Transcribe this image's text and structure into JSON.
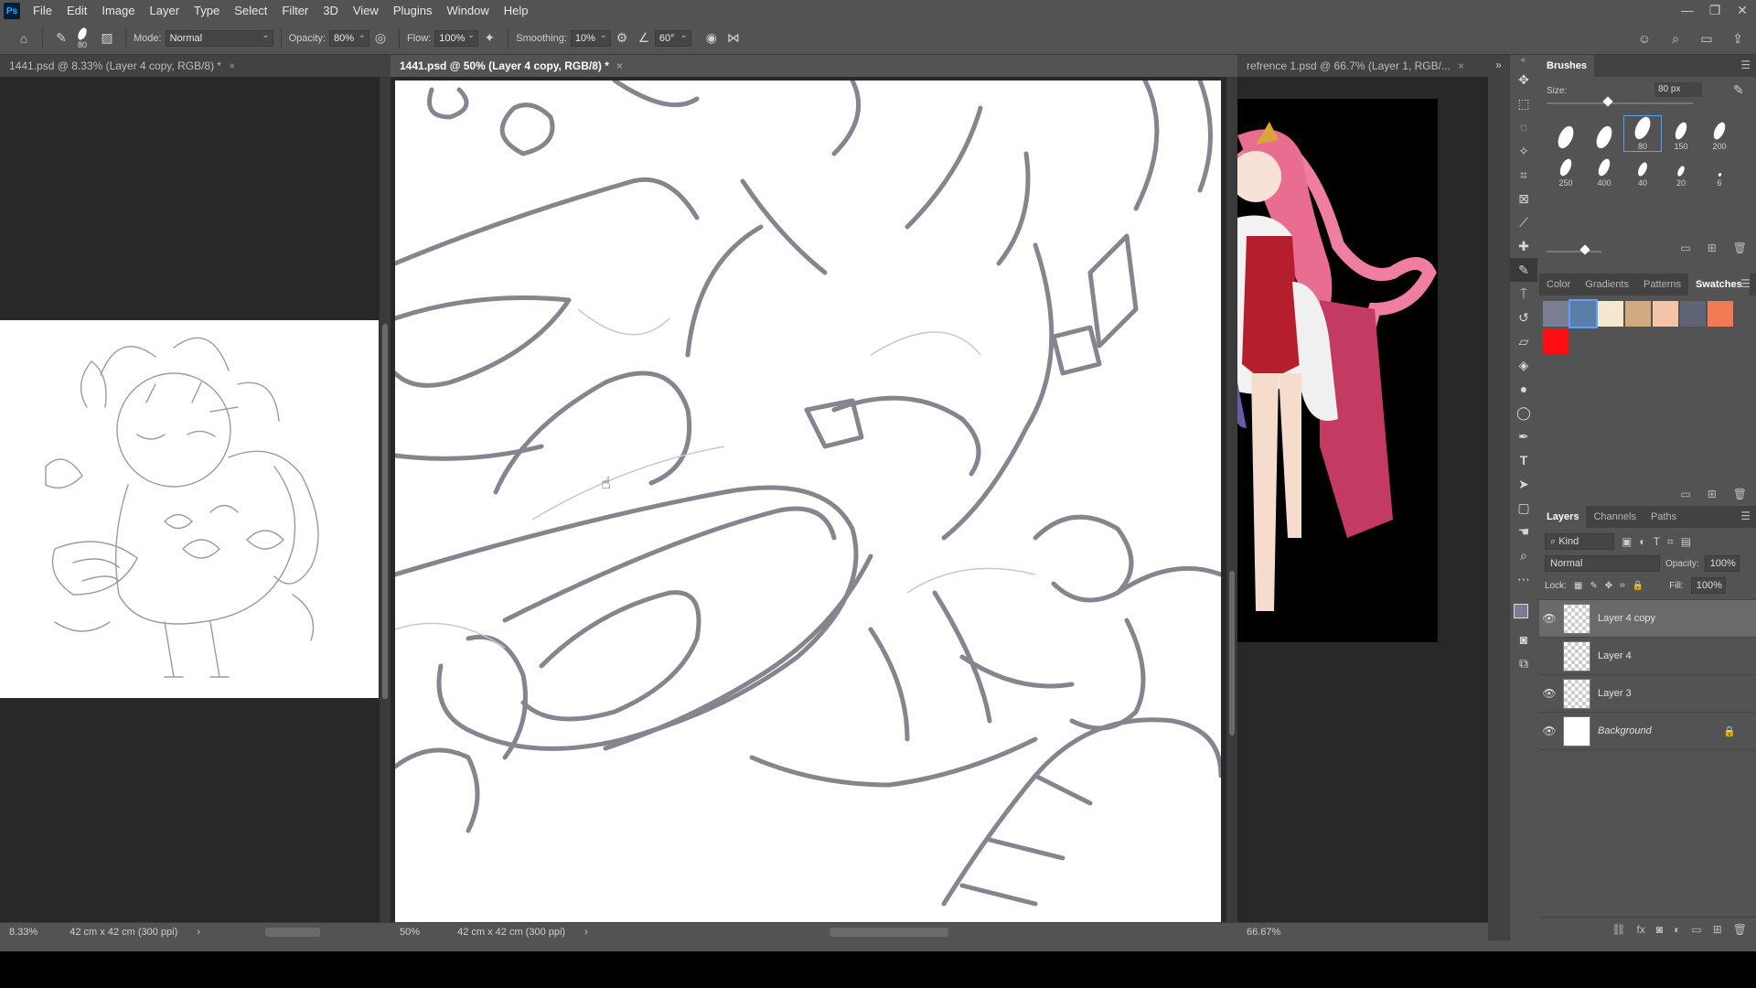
{
  "menu": {
    "logo": "Ps",
    "items": [
      "File",
      "Edit",
      "Image",
      "Layer",
      "Type",
      "Select",
      "Filter",
      "3D",
      "View",
      "Plugins",
      "Window",
      "Help"
    ]
  },
  "window_controls": [
    "—",
    "❐",
    "✕"
  ],
  "options": {
    "brush_size": "80",
    "mode_label": "Mode:",
    "mode_value": "Normal",
    "opacity_label": "Opacity:",
    "opacity_value": "80%",
    "flow_label": "Flow:",
    "flow_value": "100%",
    "smoothing_label": "Smoothing:",
    "smoothing_value": "10%",
    "angle_value": "60°"
  },
  "docs": {
    "left": {
      "tab": "1441.psd @ 8.33% (Layer 4 copy, RGB/8) *",
      "zoom": "8.33%",
      "size": "42 cm x 42 cm (300 ppi)"
    },
    "center": {
      "tab": "1441.psd @ 50% (Layer 4 copy, RGB/8) *",
      "zoom": "50%",
      "size": "42 cm x 42 cm (300 ppi)"
    },
    "right": {
      "tab": "refrence 1.psd @ 66.7% (Layer 1, RGB/...",
      "zoom": "66.67%"
    }
  },
  "brushes": {
    "title": "Brushes",
    "size_label": "Size:",
    "size_value": "80 px",
    "presets": [
      "",
      "",
      "80",
      "150",
      "200",
      "250",
      "400",
      "40",
      "20",
      "6"
    ]
  },
  "swatches": {
    "tabs": [
      "Color",
      "Gradients",
      "Patterns",
      "Swatches"
    ],
    "colors": [
      "#7a7e92",
      "#5a7ea8",
      "#f4e8d0",
      "#d2aa7f",
      "#f3c5a6",
      "#5f6474",
      "#f27b55",
      "#fd0d0f"
    ]
  },
  "layers": {
    "tabs": [
      "Layers",
      "Channels",
      "Paths"
    ],
    "kind_label": "Kind",
    "blend_mode": "Normal",
    "opacity_label": "Opacity:",
    "opacity_value": "100%",
    "lock_label": "Lock:",
    "fill_label": "Fill:",
    "fill_value": "100%",
    "items": [
      {
        "name": "Layer 4 copy",
        "visible": true
      },
      {
        "name": "Layer 4",
        "visible": false
      },
      {
        "name": "Layer 3",
        "visible": true
      },
      {
        "name": "Background",
        "visible": true
      }
    ]
  }
}
